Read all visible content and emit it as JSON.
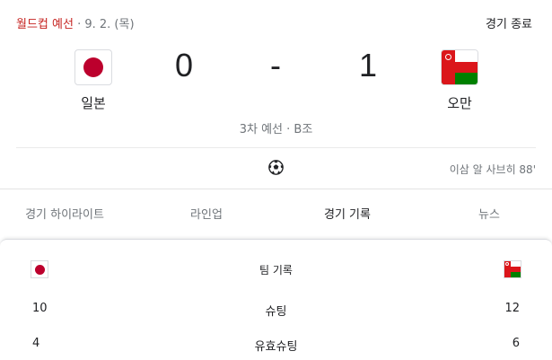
{
  "header": {
    "competition": "월드컵 예선",
    "date": " · 9. 2. (목)",
    "status": "경기 종료"
  },
  "match": {
    "home": {
      "name": "일본",
      "flag_icon": "japan-flag-icon",
      "score": "0"
    },
    "away": {
      "name": "오만",
      "flag_icon": "oman-flag-icon",
      "score": "1"
    },
    "separator": "-",
    "round": "3차 예선 · B조"
  },
  "events": {
    "icon": "soccer-ball-icon",
    "goal": "이삼 알 사브히 88'"
  },
  "tabs": [
    {
      "label": "경기 하이라이트",
      "active": false
    },
    {
      "label": "라인업",
      "active": false
    },
    {
      "label": "경기 기록",
      "active": true
    },
    {
      "label": "뉴스",
      "active": false
    }
  ],
  "stats": {
    "title": "팀 기록",
    "rows": [
      {
        "home": "10",
        "label": "슈팅",
        "away": "12"
      },
      {
        "home": "4",
        "label": "유효슈팅",
        "away": "6"
      }
    ]
  },
  "colors": {
    "competition": "#c5221f",
    "japan_red": "#bc002d",
    "oman_red": "#db161b",
    "oman_green": "#008000"
  }
}
